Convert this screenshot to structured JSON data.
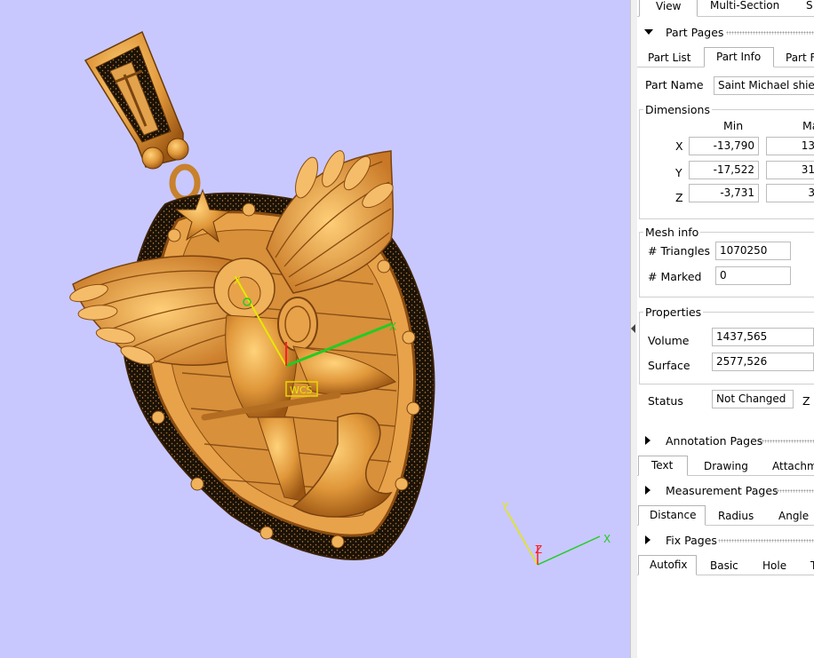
{
  "viewport": {
    "background": "#c8c8ff",
    "model": "saint-michael-shield-pendant",
    "wcs_label": "WCS",
    "axis_x": "X",
    "axis_y": "Y",
    "axis_z": "Z"
  },
  "top_tabs": [
    "View",
    "Multi-Section",
    "S"
  ],
  "part_pages": {
    "title": "Part Pages",
    "tabs": [
      "Part List",
      "Part Info",
      "Part F"
    ],
    "active_tab": "Part Info",
    "part_name_label": "Part Name",
    "part_name_value": "Saint Michael shield"
  },
  "dimensions": {
    "title": "Dimensions",
    "col_min": "Min",
    "col_max": "Ma",
    "rows": [
      {
        "axis": "X",
        "min": "-13,790",
        "max": "13"
      },
      {
        "axis": "Y",
        "min": "-17,522",
        "max": "31"
      },
      {
        "axis": "Z",
        "min": "-3,731",
        "max": "3"
      }
    ]
  },
  "mesh_info": {
    "title": "Mesh info",
    "triangles_label": "# Triangles",
    "triangles_value": "1070250",
    "marked_label": "# Marked",
    "marked_value": "0"
  },
  "properties": {
    "title": "Properties",
    "volume_label": "Volume",
    "volume_value": "1437,565",
    "surface_label": "Surface",
    "surface_value": "2577,526",
    "status_label": "Status",
    "status_value": "Not Changed",
    "extra_label": "Z"
  },
  "annotation_pages": {
    "title": "Annotation Pages",
    "tabs": [
      "Text",
      "Drawing",
      "Attachm"
    ],
    "active_tab": "Text"
  },
  "measurement_pages": {
    "title": "Measurement Pages",
    "tabs": [
      "Distance",
      "Radius",
      "Angle"
    ],
    "active_tab": "Distance"
  },
  "fix_pages": {
    "title": "Fix Pages",
    "tabs": [
      "Autofix",
      "Basic",
      "Hole",
      "T"
    ],
    "active_tab": "Autofix"
  },
  "colors": {
    "accent_gold": "#e0a040",
    "axis_x": "#22cc22",
    "axis_y": "#e8e800",
    "axis_z": "#ff2020"
  }
}
